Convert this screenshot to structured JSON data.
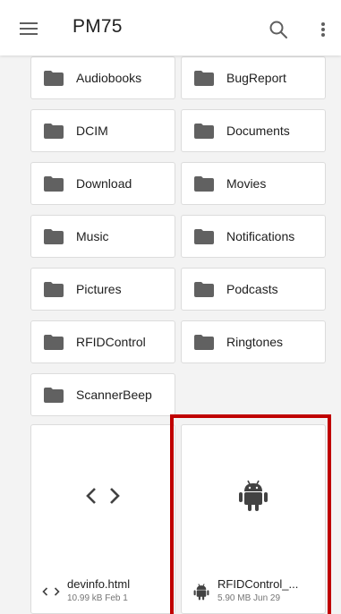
{
  "toolbar": {
    "title": "PM75",
    "menu_icon": "hamburger-menu-icon",
    "search_icon": "search-icon",
    "more_icon": "more-vert-icon"
  },
  "folders": [
    {
      "label": "Audiobooks"
    },
    {
      "label": "BugReport"
    },
    {
      "label": "DCIM"
    },
    {
      "label": "Documents"
    },
    {
      "label": "Download"
    },
    {
      "label": "Movies"
    },
    {
      "label": "Music"
    },
    {
      "label": "Notifications"
    },
    {
      "label": "Pictures"
    },
    {
      "label": "Podcasts"
    },
    {
      "label": "RFIDControl"
    },
    {
      "label": "Ringtones"
    },
    {
      "label": "ScannerBeep"
    }
  ],
  "files": [
    {
      "name": "devinfo.html",
      "info": "10.99 kB Feb 1",
      "icon": "code-icon"
    },
    {
      "name": "RFIDControl_...",
      "info": "5.90 MB Jun 29",
      "icon": "android-icon"
    }
  ],
  "colors": {
    "folder_icon": "#616161",
    "highlight": "#c00000",
    "background": "#f3f3f3"
  }
}
